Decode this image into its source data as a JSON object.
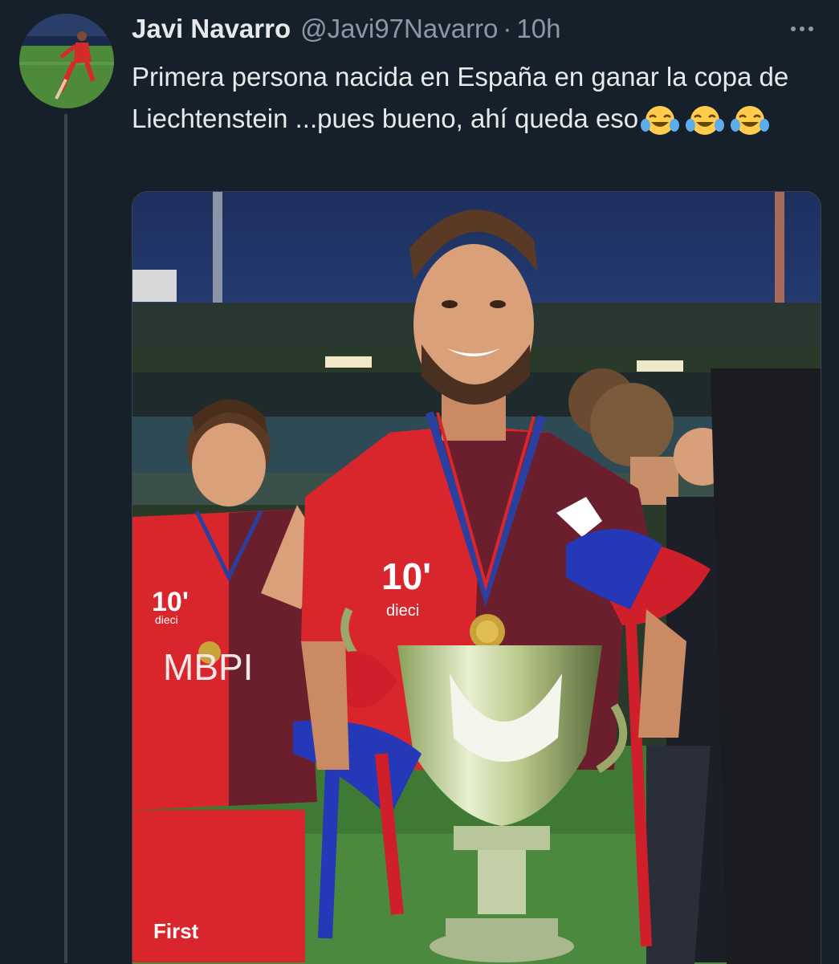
{
  "tweet": {
    "display_name": "Javi Navarro",
    "handle": "@Javi97Navarro",
    "separator": "·",
    "time": "10h",
    "text": "Primera persona nacida en España en ganar la copa de Liechtenstein ...pues bueno, ahí queda eso",
    "emojis": [
      "face-with-tears-of-joy",
      "face-with-tears-of-joy",
      "face-with-tears-of-joy"
    ]
  },
  "media": {
    "shirt_sponsor": "10'",
    "shirt_sub": "dieci",
    "shirt_brand": "MBPI",
    "shorts_sponsor": "First"
  },
  "colors": {
    "background": "#15202b",
    "text": "#e7e9ea",
    "secondary": "#8b98a5",
    "jersey_red": "#d8262c",
    "jersey_maroon": "#6b1f2c"
  }
}
